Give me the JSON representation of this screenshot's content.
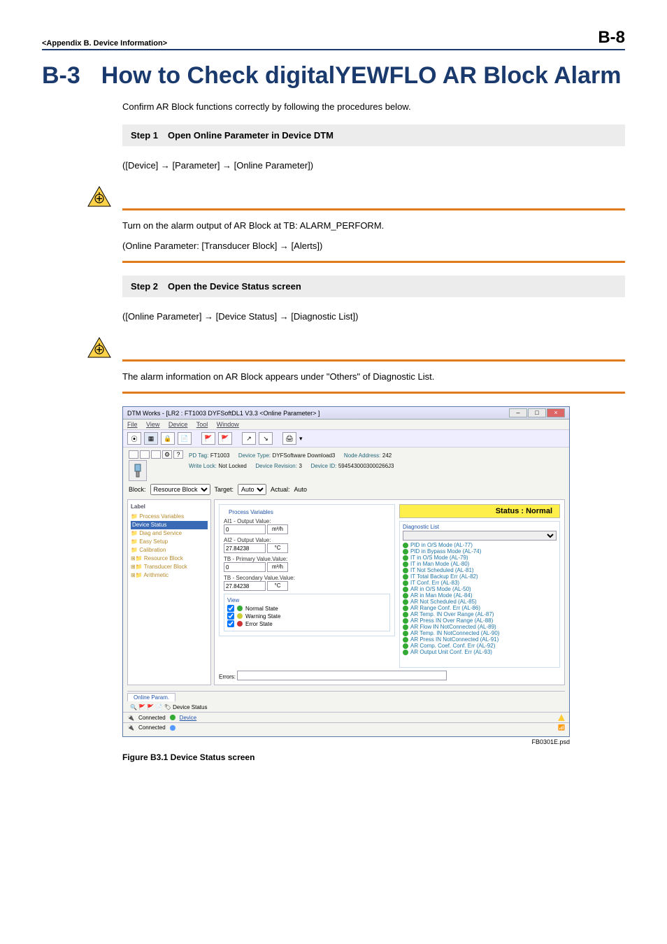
{
  "header": {
    "appendix": "<Appendix B.  Device Information>",
    "pageNumber": "B-8"
  },
  "title": {
    "number": "B-3",
    "text": "How to Check digitalYEWFLO AR Block Alarm"
  },
  "intro": "Confirm AR Block functions correctly by following the procedures below.",
  "steps": [
    {
      "num": "Step 1",
      "label": "Open Online Parameter in Device DTM"
    },
    {
      "num": "Step 2",
      "label": "Open the Device Status screen"
    }
  ],
  "paths": {
    "step1": "([Device] → [Parameter] → [Online Parameter])",
    "step2": "([Online Parameter] → [Device Status] → [Diagnostic List])"
  },
  "notes": {
    "alarmOutput": "Turn on the alarm output of AR Block at TB: ALARM_PERFORM.",
    "onlineParam": "(Online Parameter: [Transducer Block] → [Alerts])",
    "alarmInfo": "The alarm information on AR Block appears under \"Others\" of Diagnostic List."
  },
  "screenshot": {
    "windowTitle": "DTM Works - [LR2 : FT1003 DYFSoftDL1 V3.3 <Online Parameter> ]",
    "menus": [
      "File",
      "View",
      "Device",
      "Tool",
      "Window"
    ],
    "deviceInfo": {
      "pdTagLabel": "PD Tag:",
      "pdTag": "FT1003",
      "deviceTypeLabel": "Device Type:",
      "deviceType": "DYFSoftware Download3",
      "nodeAddrLabel": "Node Address:",
      "nodeAddr": "242",
      "writeLockLabel": "Write Lock:",
      "writeLock": "Not Locked",
      "deviceRevLabel": "Device Revision:",
      "deviceRev": "3",
      "deviceIdLabel": "Device ID:",
      "deviceId": "5945430003000266J3"
    },
    "blockRow": {
      "blockLabel": "Block:",
      "blockValue": "Resource Block",
      "targetLabel": "Target:",
      "targetValue": "Auto",
      "actualLabel": "Actual:",
      "actualValue": "Auto"
    },
    "tree": {
      "header": "Label",
      "items": [
        "Process Variables",
        "Device Status",
        "Diag and Service",
        "Easy Setup",
        "Calibration",
        "Resource Block",
        "Transducer Block",
        "Arithmetic"
      ]
    },
    "processVars": {
      "groupTitle": "Process Variables",
      "ai1Label": "AI1 - Output Value:",
      "ai1Value": "0",
      "ai1Unit": "m³/h",
      "ai2Label": "AI2 - Output Value:",
      "ai2Value": "27.84238",
      "ai2Unit": "°C",
      "tbPrimLabel": "TB - Primary Value.Value:",
      "tbPrimValue": "0",
      "tbPrimUnit": "m³/h",
      "tbSecLabel": "TB - Secondary Value.Value:",
      "tbSecValue": "27.84238",
      "tbSecUnit": "°C"
    },
    "viewGroup": {
      "title": "View",
      "normal": "Normal State",
      "warning": "Warning State",
      "error": "Error State"
    },
    "errorsLabel": "Errors:",
    "status": {
      "bannerLabel": "Status : Normal",
      "diagTitle": "Diagnostic List",
      "items": [
        "PID in O/S Mode (AL-77)",
        "PID in Bypass Mode (AL-74)",
        "IT in O/S Mode (AL-79)",
        "IT in Man Mode (AL-80)",
        "IT Not Scheduled (AL-81)",
        "IT Total Backup Err (AL-82)",
        "IT Conf. Err (AL-83)",
        "AR in O/S Mode (AL-50)",
        "AR in Man Mode (AL-84)",
        "AR Not Scheduled (AL-85)",
        "AR Range Conf. Err (AL-86)",
        "AR Temp. IN Over Range (AL-87)",
        "AR Press IN Over Range (AL-88)",
        "AR Flow IN NotConnected (AL-89)",
        "AR Temp. IN NotConnected (AL-90)",
        "AR Press IN NotConnected (AL-91)",
        "AR Comp. Coef. Conf. Err (AL-92)",
        "AR Output Unit Conf. Err (AL-93)"
      ]
    },
    "bottomTabs": {
      "tab1": "Online Param.",
      "tab2": "Device Status"
    },
    "statusBar": {
      "connected": "Connected",
      "device": "Device"
    },
    "figId": "FB0301E.psd"
  },
  "figure": {
    "caption": "Figure B3.1     Device Status screen"
  }
}
